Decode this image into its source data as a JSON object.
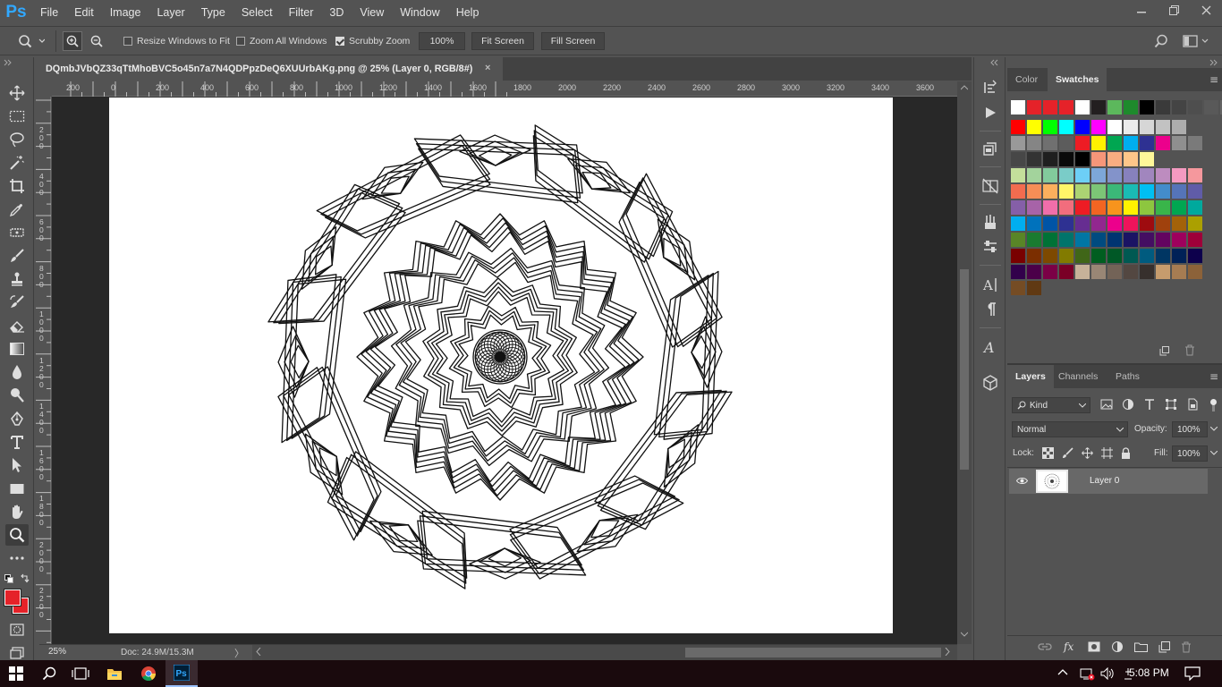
{
  "app": {
    "logo": "Ps",
    "menu": [
      "File",
      "Edit",
      "Image",
      "Layer",
      "Type",
      "Select",
      "Filter",
      "3D",
      "View",
      "Window",
      "Help"
    ],
    "window_controls": [
      "minimize",
      "restore",
      "close"
    ]
  },
  "options_bar": {
    "resize_windows_to_fit": {
      "label": "Resize Windows to Fit",
      "checked": false
    },
    "zoom_all_windows": {
      "label": "Zoom All Windows",
      "checked": false
    },
    "scrubby_zoom": {
      "label": "Scrubby Zoom",
      "checked": true
    },
    "zoom_value": "100%",
    "fit_screen": "Fit Screen",
    "fill_screen": "Fill Screen"
  },
  "document": {
    "tab_title": "DQmbJVbQZ33qTtMhoBVC5o45n7a7N4QDPpzDeQ6XUUrbAKg.png @ 25% (Layer 0, RGB/8#)",
    "tab_close": "×"
  },
  "rulers": {
    "horizontal": [
      "200",
      "0",
      "200",
      "400",
      "600",
      "800",
      "1000",
      "1200",
      "1400",
      "1600",
      "1800",
      "2000",
      "2200",
      "2400",
      "2600",
      "2800",
      "3000",
      "3200",
      "3400",
      "3600"
    ],
    "vertical": [
      "2\n0\n0",
      "4\n0\n0",
      "6\n0\n0",
      "8\n0\n0",
      "1\n0\n0\n0",
      "1\n2\n0\n0",
      "1\n4\n0\n0",
      "1\n6\n0\n0",
      "1\n8\n0\n0",
      "2\n0\n0\n0",
      "2\n2\n0\n0"
    ]
  },
  "status": {
    "zoom": "25%",
    "doc_size": "Doc: 24.9M/15.3M"
  },
  "colors": {
    "foreground": "#e52229",
    "background": "#e52229"
  },
  "color_panel": {
    "tabs": [
      "Color",
      "Swatches"
    ],
    "active_tab": "Swatches"
  },
  "swatches": {
    "rows": [
      [
        "#ffffff",
        "#e52229",
        "#e52229",
        "#e52229",
        "#ffffff",
        "#231f20",
        "#5cb85c",
        "#1e8a2c",
        "#000000",
        "#3a3a3a",
        "#444444",
        "#4e4e4e",
        "#595959",
        "#656565",
        "#8a8a8a",
        "#ffffff"
      ],
      [
        "#ff0000",
        "#ffff00",
        "#00ff00",
        "#00ffff",
        "#0000ff",
        "#ff00ff",
        "#ffffff",
        "#ebebeb",
        "#d6d6d6",
        "#c2c2c2",
        "#adadad"
      ],
      [
        "#999999",
        "#858585",
        "#707070",
        "#5c5c5c",
        "#ed1c24",
        "#fff200",
        "#00a651",
        "#00aeef",
        "#2e3192",
        "#ec008c",
        "#8f8f8f",
        "#7a7a7a"
      ],
      [
        "#474747",
        "#333333",
        "#1f1f1f",
        "#0a0a0a",
        "#000000",
        "#f69679",
        "#f9ad81",
        "#fdc689",
        "#fff799"
      ],
      [
        "#c4df9b",
        "#a3d39c",
        "#82ca9c",
        "#7accc8",
        "#6dcff6",
        "#7da7d9",
        "#8393ca",
        "#8781bd",
        "#a186be",
        "#bd8cbf",
        "#f49ac1",
        "#f5989d"
      ],
      [
        "#f26c4f",
        "#f68e56",
        "#fbaf5d",
        "#fff568",
        "#acd373",
        "#7cc576",
        "#3bb878",
        "#1abbb4",
        "#00bff3",
        "#438ccb",
        "#5574b9",
        "#605ca8"
      ],
      [
        "#855fa8",
        "#a763a8",
        "#f06eaa",
        "#f26d7d",
        "#ed1c24",
        "#f26522",
        "#f7941d",
        "#fff200",
        "#8dc63f",
        "#39b54a",
        "#00a651",
        "#00a99d"
      ],
      [
        "#00aeef",
        "#0072bc",
        "#0054a6",
        "#2e3192",
        "#662d91",
        "#92278f",
        "#ec008c",
        "#ed145b",
        "#9e0b0f",
        "#a0410d",
        "#a36209",
        "#aba000"
      ],
      [
        "#598527",
        "#1a7b30",
        "#007236",
        "#00746b",
        "#0076a3",
        "#004b80",
        "#003471",
        "#1b1464",
        "#440e62",
        "#630460",
        "#9e005d",
        "#9e0039"
      ],
      [
        "#790000",
        "#7b2e00",
        "#7d4900",
        "#827b00",
        "#406618",
        "#005e20",
        "#005826",
        "#005952",
        "#005b7f",
        "#003663",
        "#002157",
        "#0d004c"
      ],
      [
        "#32004b",
        "#4b0049",
        "#7b0046",
        "#7a0026",
        "#c7b299",
        "#998675",
        "#736357",
        "#534741",
        "#37302d",
        "#c69c6d",
        "#a67c52",
        "#8c6239"
      ],
      [
        "#754c24",
        "#603913"
      ]
    ]
  },
  "layers_panel": {
    "tabs": [
      "Layers",
      "Channels",
      "Paths"
    ],
    "active_tab": "Layers",
    "filter_kind": "Kind",
    "blend_mode": "Normal",
    "opacity_label": "Opacity:",
    "opacity_value": "100%",
    "lock_label": "Lock:",
    "fill_label": "Fill:",
    "fill_value": "100%",
    "layers": [
      {
        "name": "Layer 0",
        "visible": true
      }
    ]
  },
  "taskbar": {
    "time": "5:08 PM"
  }
}
